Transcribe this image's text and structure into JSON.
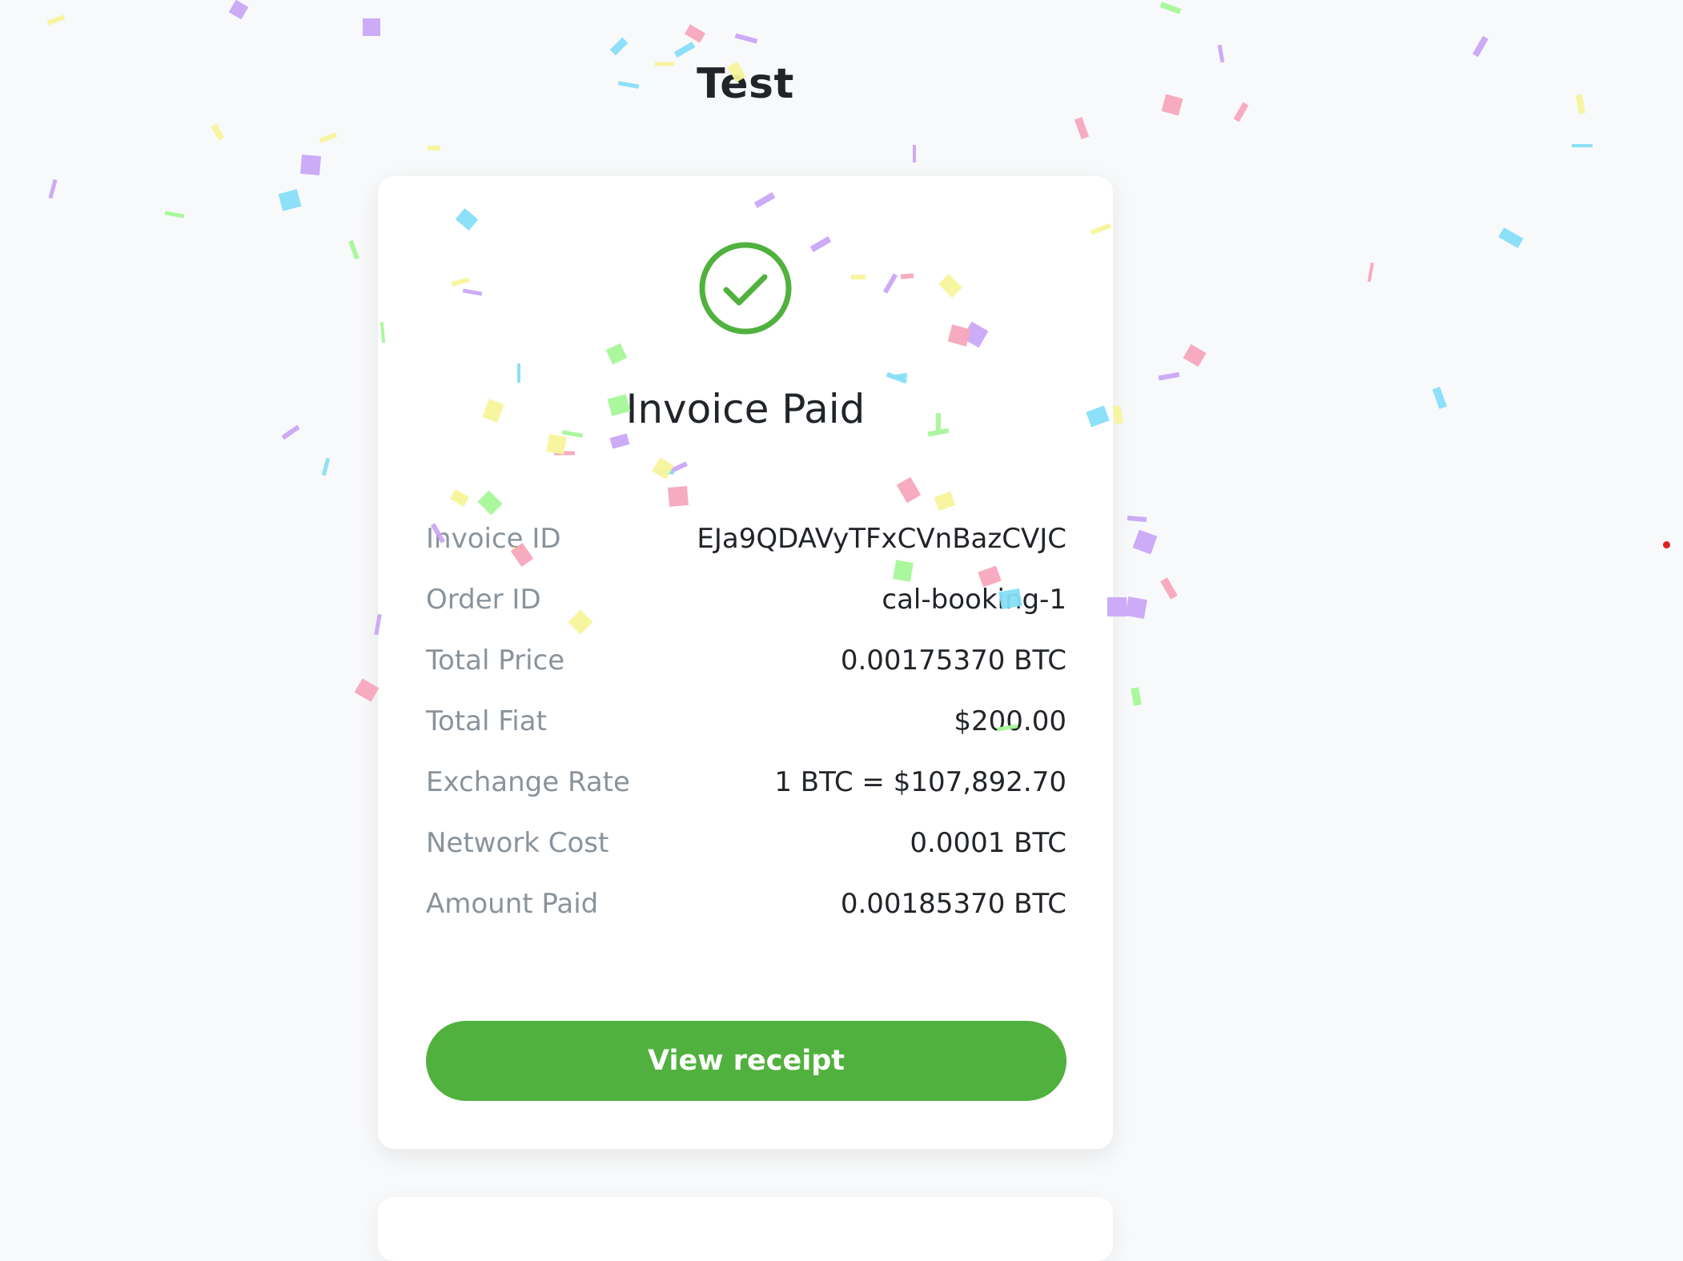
{
  "store": {
    "title": "Test"
  },
  "invoice": {
    "status_title": "Invoice Paid",
    "icon": "check-circle-icon",
    "status_color": "#51b13e",
    "rows": [
      {
        "label": "Invoice ID",
        "value": "EJa9QDAVyTFxCVnBazCVJC"
      },
      {
        "label": "Order ID",
        "value": "cal-booking-1"
      },
      {
        "label": "Total Price",
        "value": "0.00175370 BTC"
      },
      {
        "label": "Total Fiat",
        "value": "$200.00"
      },
      {
        "label": "Exchange Rate",
        "value": "1 BTC = $107,892.70"
      },
      {
        "label": "Network Cost",
        "value": "0.0001 BTC"
      },
      {
        "label": "Amount Paid",
        "value": "0.00185370 BTC"
      }
    ],
    "button_label": "View receipt"
  },
  "confetti_colors": [
    "#c9a6f7",
    "#86def7",
    "#f7a6bd",
    "#f7f49a",
    "#a6f799"
  ]
}
